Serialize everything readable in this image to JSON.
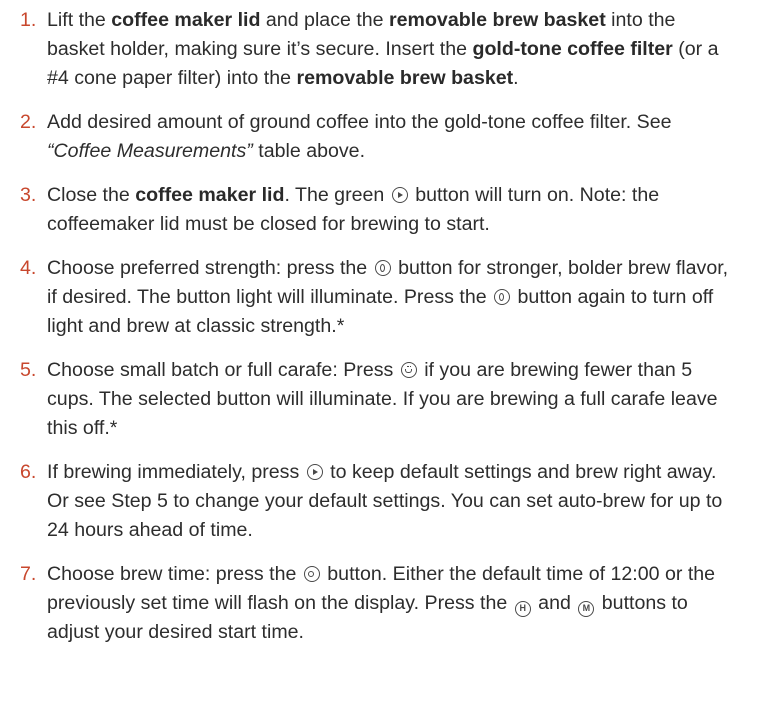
{
  "steps": [
    {
      "number": "1.",
      "segments": [
        {
          "t": "Lift the "
        },
        {
          "t": "coffee maker lid",
          "style": "bold"
        },
        {
          "t": " and place the "
        },
        {
          "t": "removable brew basket",
          "style": "bold"
        },
        {
          "t": " into the basket holder, making sure it’s secure. Insert the "
        },
        {
          "t": "gold-tone coffee filter",
          "style": "bold"
        },
        {
          "t": " (or a #4 cone paper filter) into the "
        },
        {
          "t": "removable brew basket",
          "style": "bold"
        },
        {
          "t": "."
        }
      ]
    },
    {
      "number": "2.",
      "segments": [
        {
          "t": "Add desired amount of ground coffee into the gold-tone coffee filter. See "
        },
        {
          "t": "“Coffee Measurements”",
          "style": "italic"
        },
        {
          "t": " table above."
        }
      ]
    },
    {
      "number": "3.",
      "segments": [
        {
          "t": "Close the "
        },
        {
          "t": "coffee maker lid",
          "style": "bold"
        },
        {
          "t": ". The green "
        },
        {
          "icon": "play-button-icon"
        },
        {
          "t": " button will turn on. Note: the coffeemaker lid must be closed for brewing to start."
        }
      ]
    },
    {
      "number": "4.",
      "segments": [
        {
          "t": "Choose preferred strength: press the "
        },
        {
          "icon": "bold-brew-icon"
        },
        {
          "t": " button for stronger, bolder brew flavor, if desired. The button light will illuminate. Press the "
        },
        {
          "icon": "bold-brew-icon"
        },
        {
          "t": " button again to turn off light and brew at classic strength.*"
        }
      ]
    },
    {
      "number": "5.",
      "segments": [
        {
          "t": "Choose small batch or full carafe: Press "
        },
        {
          "icon": "small-batch-icon"
        },
        {
          "t": " if you are brewing fewer than 5 cups. The selected button will illuminate. If you are brewing a full carafe leave this off.*"
        }
      ]
    },
    {
      "number": "6.",
      "segments": [
        {
          "t": "If brewing immediately, press "
        },
        {
          "icon": "play-button-icon"
        },
        {
          "t": " to keep default settings and brew right away. Or see Step 5 to change your default settings. You can set auto-brew for up to 24 hours ahead of time."
        }
      ]
    },
    {
      "number": "7.",
      "segments": [
        {
          "t": "Choose brew time: press the "
        },
        {
          "icon": "auto-brew-clock-icon"
        },
        {
          "t": " button. Either the default time of 12:00 or the previously set time will flash on the display. Press the "
        },
        {
          "icon": "hour-button-icon",
          "glyph": "H"
        },
        {
          "t": " and "
        },
        {
          "icon": "minute-button-icon",
          "glyph": "M"
        },
        {
          "t": " buttons to adjust your desired start time."
        }
      ]
    }
  ]
}
